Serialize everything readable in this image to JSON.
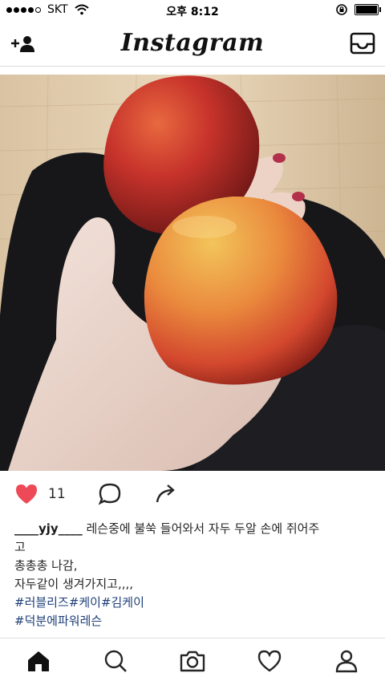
{
  "status_bar": {
    "carrier": "SKT",
    "time": "오후 8:12",
    "signal_bars": 4,
    "battery_level": 1.0
  },
  "nav": {
    "logo": "Instagram",
    "icons": [
      "add-user-icon",
      "inbox-icon"
    ]
  },
  "post": {
    "photo_subject": "hand holding two plums",
    "liked": true,
    "like_count": "11",
    "caption": {
      "username": "____yjy____",
      "line1_text": " 레슨중에 불쑥 들어와서 자두 두알 손에 쥐어주",
      "line2": "고",
      "line3": "총총총 나감,",
      "line4": "자두같이 생겨가지고,,,,",
      "tags1": "#러블리즈#케이#김케이",
      "tags2": "#덕분에파워레슨"
    },
    "colors": {
      "like": "#ed4956",
      "hashtag": "#1e3f78"
    }
  },
  "tab_bar": {
    "tabs": [
      "home-icon",
      "search-icon",
      "camera-icon",
      "heart-icon",
      "profile-icon"
    ],
    "active": "home-icon"
  }
}
